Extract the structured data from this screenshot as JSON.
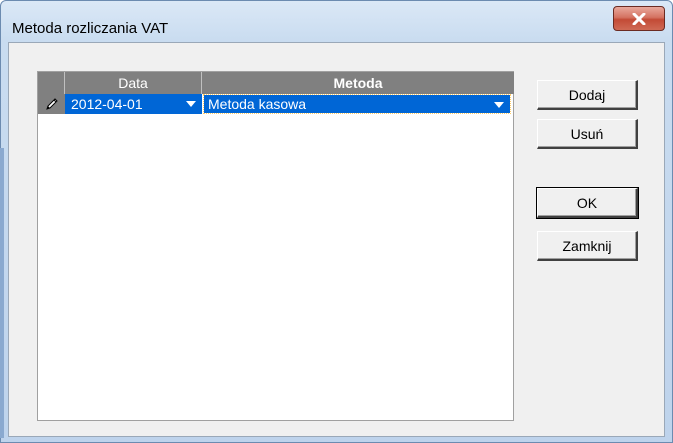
{
  "window": {
    "title": "Metoda rozliczania VAT",
    "close_icon": "close-icon"
  },
  "grid": {
    "columns": [
      "Data",
      "Metoda"
    ],
    "rows": [
      {
        "indicator_icon": "pencil-icon",
        "data": "2012-04-01",
        "metoda": "Metoda kasowa"
      }
    ]
  },
  "buttons": {
    "add": "Dodaj",
    "remove": "Usuń",
    "ok": "OK",
    "close": "Zamknij"
  },
  "colors": {
    "selection": "#0066d6",
    "header": "#808080",
    "close_button": "#c34b36"
  }
}
